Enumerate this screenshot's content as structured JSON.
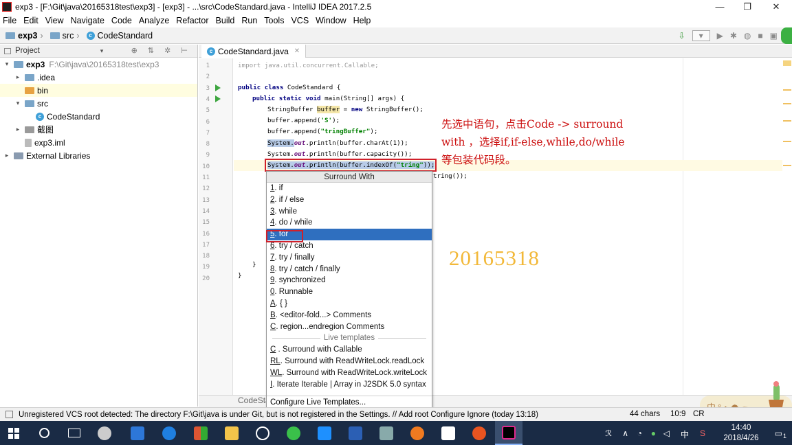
{
  "window": {
    "title": "exp3 - [F:\\Git\\java\\20165318test\\exp3] - [exp3] - ...\\src\\CodeStandard.java - IntelliJ IDEA 2017.2.5",
    "minimize": "—",
    "maximize": "❐",
    "close": "✕"
  },
  "menu": [
    "File",
    "Edit",
    "View",
    "Navigate",
    "Code",
    "Analyze",
    "Refactor",
    "Build",
    "Run",
    "Tools",
    "VCS",
    "Window",
    "Help"
  ],
  "breadcrumb": [
    "exp3",
    "src",
    "CodeStandard"
  ],
  "project_panel": {
    "title": "Project",
    "tree": [
      {
        "label": "exp3",
        "path": "F:\\Git\\java\\20165318test\\exp3",
        "indent": 0,
        "arrow": "▾",
        "icon": "folder-icon",
        "bold": true
      },
      {
        "label": ".idea",
        "indent": 1,
        "arrow": "▸",
        "icon": "folder-icon"
      },
      {
        "label": "bin",
        "indent": 1,
        "arrow": "",
        "icon": "folder-orange-icon",
        "selected": true
      },
      {
        "label": "src",
        "indent": 1,
        "arrow": "▾",
        "icon": "folder-icon"
      },
      {
        "label": "CodeStandard",
        "indent": 2,
        "arrow": "",
        "icon": "class-icon"
      },
      {
        "label": "截图",
        "indent": 1,
        "arrow": "▸",
        "icon": "folder-icon"
      },
      {
        "label": "exp3.iml",
        "indent": 1,
        "arrow": "",
        "icon": "iml-file-icon"
      },
      {
        "label": "External Libraries",
        "indent": 0,
        "arrow": "▸",
        "icon": "library-icon"
      }
    ]
  },
  "editor": {
    "tab": "CodeStandard.java",
    "line_numbers": [
      "1",
      "2",
      "3",
      "4",
      "5",
      "6",
      "7",
      "8",
      "9",
      "10",
      "11",
      "12",
      "13",
      "14",
      "15",
      "16",
      "17",
      "18",
      "19",
      "20"
    ],
    "code": {
      "l1": "import java.util.concurrent.Callable;",
      "l3_kw": "public class",
      "l3_rest": " CodeStandard {",
      "l4_kw": "public static void",
      "l4_rest": " main(String[] args) {",
      "l5_a": "StringBuffer ",
      "l5_var": "buffer",
      "l5_b": " = ",
      "l5_kw": "new",
      "l5_c": " StringBuffer();",
      "l6_a": "buffer.append(",
      "l6_str": "'S'",
      "l6_b": ");",
      "l7_a": "buffer.append(",
      "l7_str": "\"tringBuffer\"",
      "l7_b": ");",
      "l8_a": "System.",
      "l8_f": "out",
      "l8_b": ".println(buffer.charAt(1));",
      "l9_a": "System.",
      "l9_f": "out",
      "l9_b": ".println(buffer.capacity());",
      "l10_a": "System.",
      "l10_f": "out",
      "l10_b": ".println(buffer.indexOf(",
      "l10_str": "\"tring\"",
      "l10_c": "));",
      "l11_tail": "tring());",
      "l19": "}",
      "l20": "}"
    },
    "bottom_label": "CodeSta"
  },
  "annotation": {
    "line1": "先选中语句，点击Code -> surround",
    "line2": "with ，选择if,if-else,while,do/while",
    "line3": "等包装代码段。"
  },
  "student_id": "20165318",
  "popup": {
    "title": "Surround With",
    "items": [
      {
        "m": "1",
        "rest": ". if"
      },
      {
        "m": "2",
        "rest": ". if / else"
      },
      {
        "m": "3",
        "rest": ". while"
      },
      {
        "m": "4",
        "rest": ". do / while"
      },
      {
        "m": "5",
        "rest": ". for",
        "active": true
      },
      {
        "m": "6",
        "rest": ". try / catch"
      },
      {
        "m": "7",
        "rest": ". try / finally"
      },
      {
        "m": "8",
        "rest": ". try / catch / finally"
      },
      {
        "m": "9",
        "rest": ". synchronized"
      },
      {
        "m": "0",
        "rest": ". Runnable"
      },
      {
        "m": "A",
        "rest": ". { }"
      },
      {
        "m": "B",
        "rest": ". <editor-fold...> Comments"
      },
      {
        "m": "C",
        "rest": ". region...endregion Comments"
      }
    ],
    "live_templates_label": "Live templates",
    "live_items": [
      {
        "m": "C",
        "rest": " . Surround with Callable"
      },
      {
        "m": "RL",
        "rest": ". Surround with ReadWriteLock.readLock"
      },
      {
        "m": "WL",
        "rest": ". Surround with ReadWriteLock.writeLock"
      },
      {
        "m": "I",
        "rest": ". Iterate Iterable | Array in J2SDK 5.0 syntax"
      }
    ],
    "footer": "Configure Live Templates..."
  },
  "status": {
    "message": "Unregistered VCS root detected: The directory F:\\Git\\java is under Git, but is not registered in the Settings. // Add root  Configure  Ignore (today 13:18)",
    "chars": "44 chars",
    "position": "10:9",
    "crlf": "CR"
  },
  "taskbar": {
    "time": "14:40",
    "date": "2018/4/26",
    "ime_lang": "中",
    "notif_count": "1",
    "ime_widget": "中°◐☂☼"
  },
  "colors": {
    "highlight_box": "#d0202a",
    "selected_item": "#2f6fbf",
    "annotation": "#cc1010",
    "student_id": "#f2b838"
  }
}
